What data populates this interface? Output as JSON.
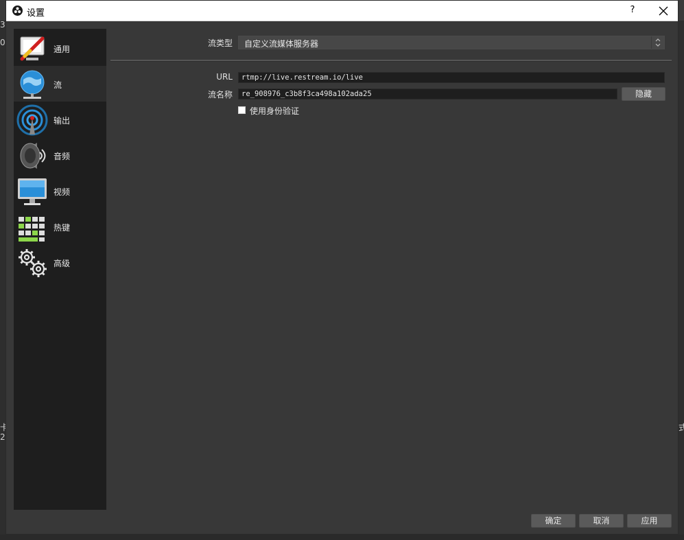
{
  "window": {
    "title": "设置",
    "help_label": "?"
  },
  "sidebar": {
    "items": [
      {
        "label": "通用",
        "icon": "general-icon"
      },
      {
        "label": "流",
        "icon": "stream-globe-icon",
        "active": true
      },
      {
        "label": "输出",
        "icon": "output-antenna-icon"
      },
      {
        "label": "音频",
        "icon": "audio-speaker-icon"
      },
      {
        "label": "视频",
        "icon": "video-monitor-icon"
      },
      {
        "label": "热键",
        "icon": "hotkeys-keyboard-icon"
      },
      {
        "label": "高级",
        "icon": "advanced-gears-icon"
      }
    ]
  },
  "stream": {
    "type_label": "流类型",
    "type_value": "自定义流媒体服务器",
    "url_label": "URL",
    "url_value": "rtmp://live.restream.io/live",
    "key_label": "流名称",
    "key_value": "re_908976_c3b8f3ca498a102ada25",
    "hide_button": "隐藏",
    "auth_label": "使用身份验证",
    "auth_checked": false
  },
  "footer": {
    "ok": "确定",
    "cancel": "取消",
    "apply": "应用"
  },
  "background_app": {
    "edge_chars_left": [
      "3",
      "0",
      "卡",
      "2"
    ],
    "edge_chars_right": [
      "式"
    ]
  },
  "colors": {
    "dialog_bg": "#383838",
    "sidebar_bg": "#1e1e1e",
    "accent_blue": "#2a8fd8"
  }
}
